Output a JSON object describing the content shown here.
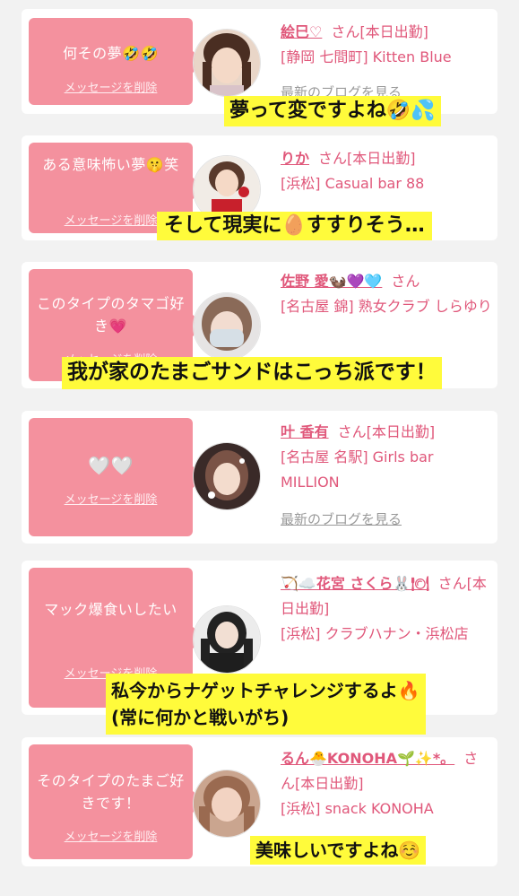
{
  "delete_label": "メッセージを削除",
  "blog_label": "最新のブログを見る",
  "san": "さん",
  "colors": {
    "bubble": "#f4919e",
    "accent": "#e0577a",
    "caption_bg": "#fffb3b"
  },
  "cards": [
    {
      "message": "何その夢🤣🤣",
      "name": "絵巳♡",
      "status": "[本日出勤]",
      "location": "[静岡 七間町] Kitten Blue",
      "caption": "夢って変ですよね🤣💦"
    },
    {
      "message": "ある意味怖い夢🤫笑",
      "name": "りか",
      "status": "[本日出勤]",
      "location": "[浜松] Casual bar 88",
      "caption": "そして現実に🥚すすりそう…"
    },
    {
      "message": "このタイプのタマゴ好き💗",
      "name": "佐野 愛🦦💜🩵",
      "status": "",
      "location": "[名古屋 錦] 熟女クラブ しらゆり",
      "caption": "我が家のたまごサンドはこっち派です！"
    },
    {
      "message": "🤍🤍",
      "name": "叶 香有",
      "status": "[本日出勤]",
      "location": "[名古屋 名駅] Girls bar MILLION",
      "caption": ""
    },
    {
      "message": "マック爆食いしたい",
      "name": "🏹☁️花宮 さくら🐰🍽",
      "status": "[本日出勤]",
      "location": "[浜松] クラブハナン・浜松店",
      "caption": "私今からナゲットチャレンジするよ🔥",
      "caption2": "(常に何かと戦いがち)"
    },
    {
      "message": "そのタイプのたまご好きです！",
      "name": "るん🐣KONOHA🌱✨*。",
      "status": "[本日出勤]",
      "location": "[浜松] snack KONOHA",
      "caption": "美味しいですよね☺️"
    }
  ]
}
